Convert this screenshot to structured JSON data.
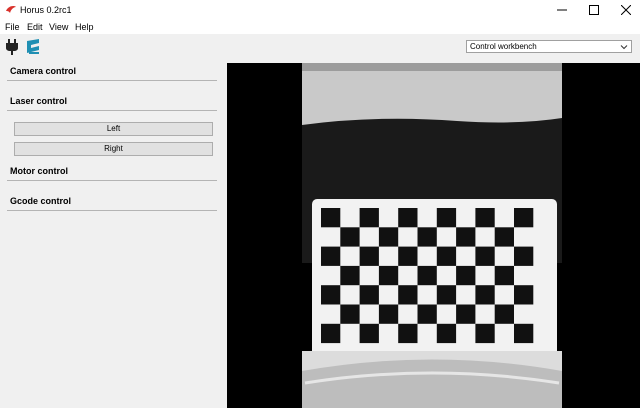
{
  "window": {
    "title": "Horus 0.2rc1"
  },
  "menu": {
    "items": [
      "File",
      "Edit",
      "View",
      "Help"
    ]
  },
  "toolbar": {
    "connect_icon": "plug-icon",
    "scanner_icon": "scanner-icon",
    "workbench_selected": "Control workbench"
  },
  "sidebar": {
    "camera_control": "Camera control",
    "laser_control": "Laser control",
    "laser_left": "Left",
    "laser_right": "Right",
    "motor_control": "Motor control",
    "gcode_control": "Gcode control"
  },
  "viewer": {
    "content": "camera-feed-checkerboard-pattern",
    "pattern_rows": 7,
    "pattern_cols": 11
  },
  "colors": {
    "app_icon": "#d9312b",
    "accent_teal": "#1f8fb3",
    "background": "#f0f0f0"
  }
}
